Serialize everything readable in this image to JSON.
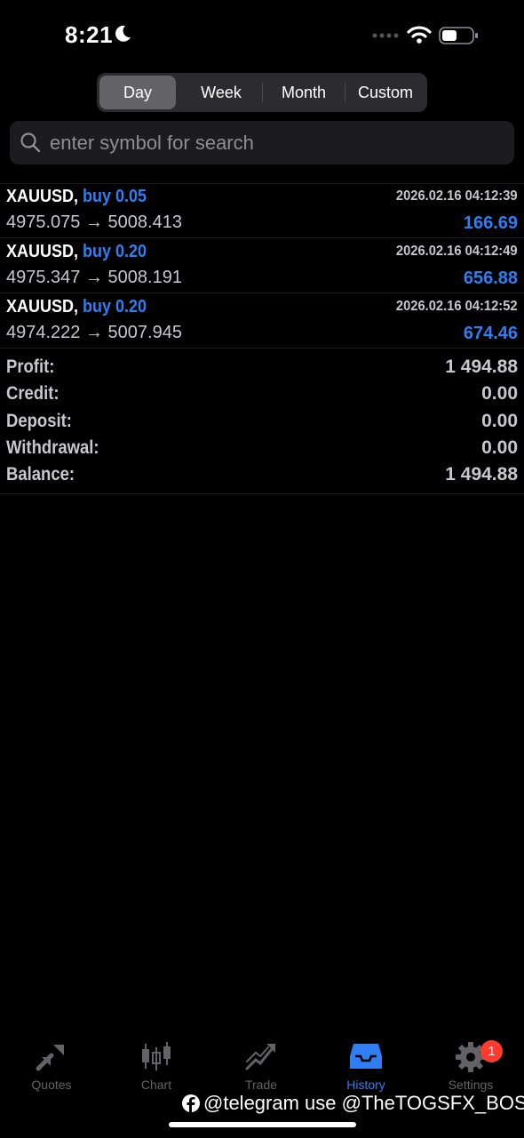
{
  "status": {
    "time": "8:21"
  },
  "segments": {
    "tabs": [
      "Day",
      "Week",
      "Month",
      "Custom"
    ],
    "active": "Day"
  },
  "search": {
    "placeholder": "enter symbol for search"
  },
  "deals": [
    {
      "symbol": "XAUUSD,",
      "side": "buy 0.05",
      "time": "2026.02.16 04:12:39",
      "open": "4975.075",
      "close": "5008.413",
      "arrow": "→",
      "profit": "166.69"
    },
    {
      "symbol": "XAUUSD,",
      "side": "buy 0.20",
      "time": "2026.02.16 04:12:49",
      "open": "4975.347",
      "close": "5008.191",
      "arrow": "→",
      "profit": "656.88"
    },
    {
      "symbol": "XAUUSD,",
      "side": "buy 0.20",
      "time": "2026.02.16 04:12:52",
      "open": "4974.222",
      "close": "5007.945",
      "arrow": "→",
      "profit": "674.46"
    }
  ],
  "summary": [
    {
      "label": "Profit:",
      "value": "1 494.88"
    },
    {
      "label": "Credit:",
      "value": "0.00"
    },
    {
      "label": "Deposit:",
      "value": "0.00"
    },
    {
      "label": "Withdrawal:",
      "value": "0.00"
    },
    {
      "label": "Balance:",
      "value": "1 494.88"
    }
  ],
  "tabbar": {
    "items": [
      {
        "label": "Quotes",
        "icon": "quotes-icon"
      },
      {
        "label": "Chart",
        "icon": "chart-icon"
      },
      {
        "label": "Trade",
        "icon": "trade-icon"
      },
      {
        "label": "History",
        "icon": "history-icon",
        "active": true
      },
      {
        "label": "Settings",
        "icon": "settings-icon",
        "badge": "1"
      }
    ]
  },
  "watermark": "@telegram use @TheTOGSFX_BOSS",
  "colors": {
    "accent": "#2f7ef2",
    "background": "#000000",
    "badge": "#ff3b30",
    "inactive": "#636366"
  }
}
